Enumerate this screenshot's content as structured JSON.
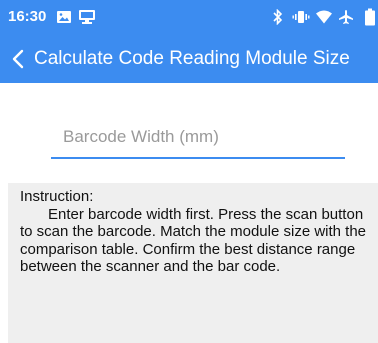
{
  "status_bar": {
    "time": "16:30",
    "icons": [
      "image-icon",
      "monitor-icon",
      "bluetooth-icon",
      "vibrate-icon",
      "wifi-icon",
      "airplane-icon",
      "battery-icon"
    ],
    "color": "#3c8cf0"
  },
  "app_bar": {
    "back_icon": "chevron-left-icon",
    "title": "Calculate Code Reading Module Size",
    "color": "#3c8cf0"
  },
  "form": {
    "barcode_width_placeholder": "Barcode Width (mm)",
    "barcode_width_value": "",
    "accent": "#3c8cf0"
  },
  "instruction": {
    "heading": "Instruction:",
    "body": "Enter barcode width first. Press the scan button to scan the barcode. Match the module size with the comparison table. Confirm the best distance range between the scanner and the bar code.",
    "background": "#efefef"
  }
}
